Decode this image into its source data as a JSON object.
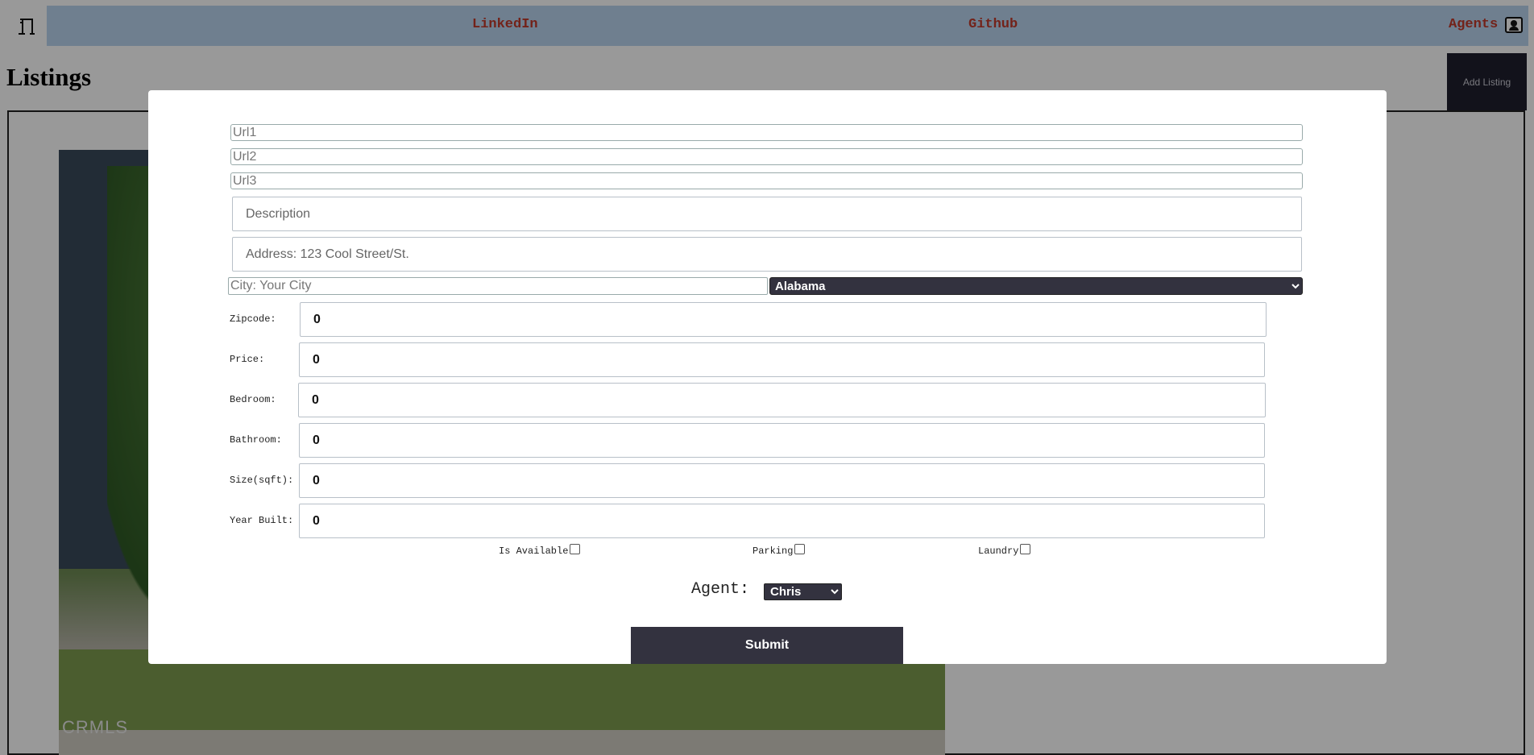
{
  "nav": {
    "linkedin": "LinkedIn",
    "github": "Github",
    "agents": "Agents"
  },
  "page": {
    "title": "Listings",
    "add_listing_label": "Add Listing"
  },
  "photo": {
    "watermark": "CRMLS"
  },
  "form": {
    "url1_placeholder": "Url1",
    "url2_placeholder": "Url2",
    "url3_placeholder": "Url3",
    "description_placeholder": "Description",
    "address_placeholder": "Address: 123 Cool Street/St.",
    "city_placeholder": "City: Your City",
    "state_selected": "Alabama",
    "zipcode_label": "Zipcode:",
    "zipcode_value": "0",
    "price_label": "Price:",
    "price_value": "0",
    "bedroom_label": "Bedroom:",
    "bedroom_value": "0",
    "bathroom_label": "Bathroom:",
    "bathroom_value": "0",
    "size_label": "Size(sqft):",
    "size_value": "0",
    "year_built_label": "Year Built:",
    "year_built_value": "0",
    "is_available_label": "Is Available",
    "parking_label": "Parking",
    "laundry_label": "Laundry",
    "agent_label": "Agent:",
    "agent_selected": "Chris",
    "submit_label": "Submit"
  }
}
